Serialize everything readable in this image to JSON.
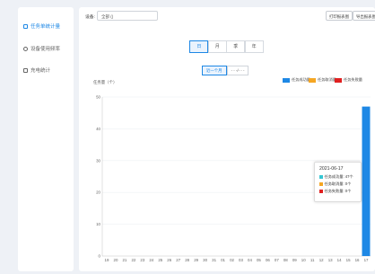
{
  "sidebar": {
    "items": [
      {
        "label": "任务单统计量",
        "active": true
      },
      {
        "label": "设备使用频率",
        "active": false
      },
      {
        "label": "充电统计",
        "active": false
      }
    ]
  },
  "toolbar": {
    "device_label": "设备:",
    "device_value": "全部 ()",
    "print_button": "打印报表图",
    "export_button": "导出报表图"
  },
  "period_tabs": [
    "日",
    "月",
    "季",
    "年"
  ],
  "active_period": "日",
  "range": {
    "recent_label": "近一个月",
    "date_placeholder": "- - -/- - -"
  },
  "colors": {
    "accent": "#1e88e5",
    "success": "#1e88e5",
    "cancel": "#f5a623",
    "fail": "#e02020",
    "tooltip_success": "#36c6d3"
  },
  "chart_data": {
    "type": "bar",
    "ylabel": "任务量（个）",
    "ylim": [
      0,
      50
    ],
    "yticks": [
      0,
      10,
      20,
      30,
      40,
      50
    ],
    "categories": [
      "19",
      "20",
      "21",
      "22",
      "23",
      "24",
      "25",
      "26",
      "27",
      "28",
      "29",
      "30",
      "31",
      "01",
      "02",
      "03",
      "04",
      "05",
      "06",
      "07",
      "08",
      "09",
      "10",
      "11",
      "12",
      "13",
      "14",
      "15",
      "16",
      "17"
    ],
    "series": [
      {
        "name": "任务成功量",
        "values": [
          0,
          0,
          0,
          0,
          0,
          0,
          0,
          0,
          0,
          0,
          0,
          0,
          0,
          0,
          0,
          0,
          0,
          0,
          0,
          0,
          0,
          0,
          0,
          0,
          0,
          0,
          0,
          0,
          0,
          47
        ]
      },
      {
        "name": "任务取消量",
        "values": [
          0,
          0,
          0,
          0,
          0,
          0,
          0,
          0,
          0,
          0,
          0,
          0,
          0,
          0,
          0,
          0,
          0,
          0,
          0,
          0,
          0,
          0,
          0,
          0,
          0,
          0,
          0,
          0,
          0,
          0
        ]
      },
      {
        "name": "任务失败量",
        "values": [
          0,
          0,
          0,
          0,
          0,
          0,
          0,
          0,
          0,
          0,
          0,
          0,
          0,
          0,
          0,
          0,
          0,
          0,
          0,
          0,
          0,
          0,
          0,
          0,
          0,
          0,
          0,
          0,
          0,
          0
        ]
      }
    ],
    "grid": true,
    "legend_position": "top-right"
  },
  "tooltip": {
    "date": "2021-06-17",
    "rows": [
      "任务成功量: 47个",
      "任务取消量: 0个",
      "任务失败量: 0个"
    ]
  }
}
